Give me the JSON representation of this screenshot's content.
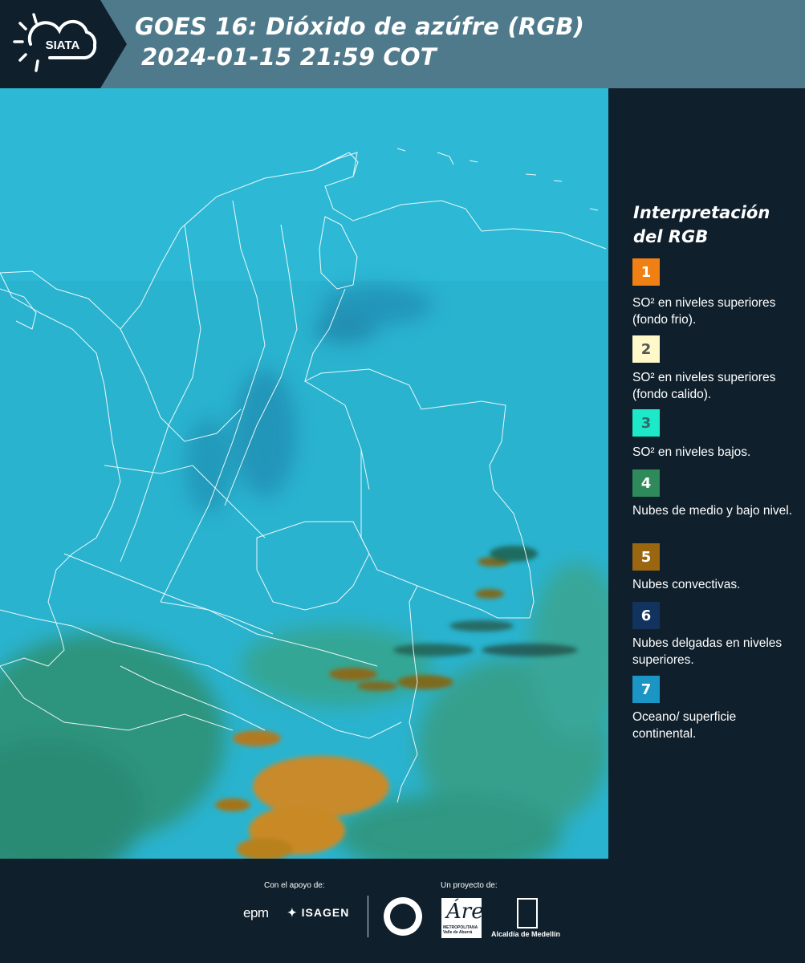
{
  "header": {
    "logo_text": "SIATA",
    "title_line1": "GOES 16: Dióxido de azúfre (RGB)",
    "title_line2": "2024-01-15 21:59 COT"
  },
  "legend": {
    "title": "Interpretación del RGB",
    "items": [
      {
        "number": "1",
        "color": "#f07f14",
        "number_color": "#ffffff",
        "text": "SO² en niveles superiores (fondo frio)."
      },
      {
        "number": "2",
        "color": "#fff8c8",
        "number_color": "#555555",
        "text": "SO² en niveles superiores (fondo calido)."
      },
      {
        "number": "3",
        "color": "#1de9c8",
        "number_color": "#2e6b6b",
        "text": "SO² en niveles bajos."
      },
      {
        "number": "4",
        "color": "#2e8a5a",
        "number_color": "#ffffff",
        "text": "Nubes de medio y bajo nivel."
      },
      {
        "number": "5",
        "color": "#9b6610",
        "number_color": "#ffffff",
        "text": "Nubes convectivas."
      },
      {
        "number": "6",
        "color": "#12335e",
        "number_color": "#ffffff",
        "text": "Nubes delgadas en niveles superiores."
      },
      {
        "number": "7",
        "color": "#1b95c4",
        "number_color": "#ffffff",
        "text": "Oceano/ superficie continental."
      }
    ]
  },
  "footer": {
    "support_label": "Con el apoyo de:",
    "project_label": "Un proyecto de:",
    "epm": "epm",
    "isagen": "ISAGEN",
    "area_logo": "Área",
    "area_sub": "METROPOLITANA Valle de Aburrá",
    "alcaldia": "Alcaldía de Medellín"
  },
  "map": {
    "background_color": "#2ab3cf",
    "boundary_color": "#ffffff"
  }
}
